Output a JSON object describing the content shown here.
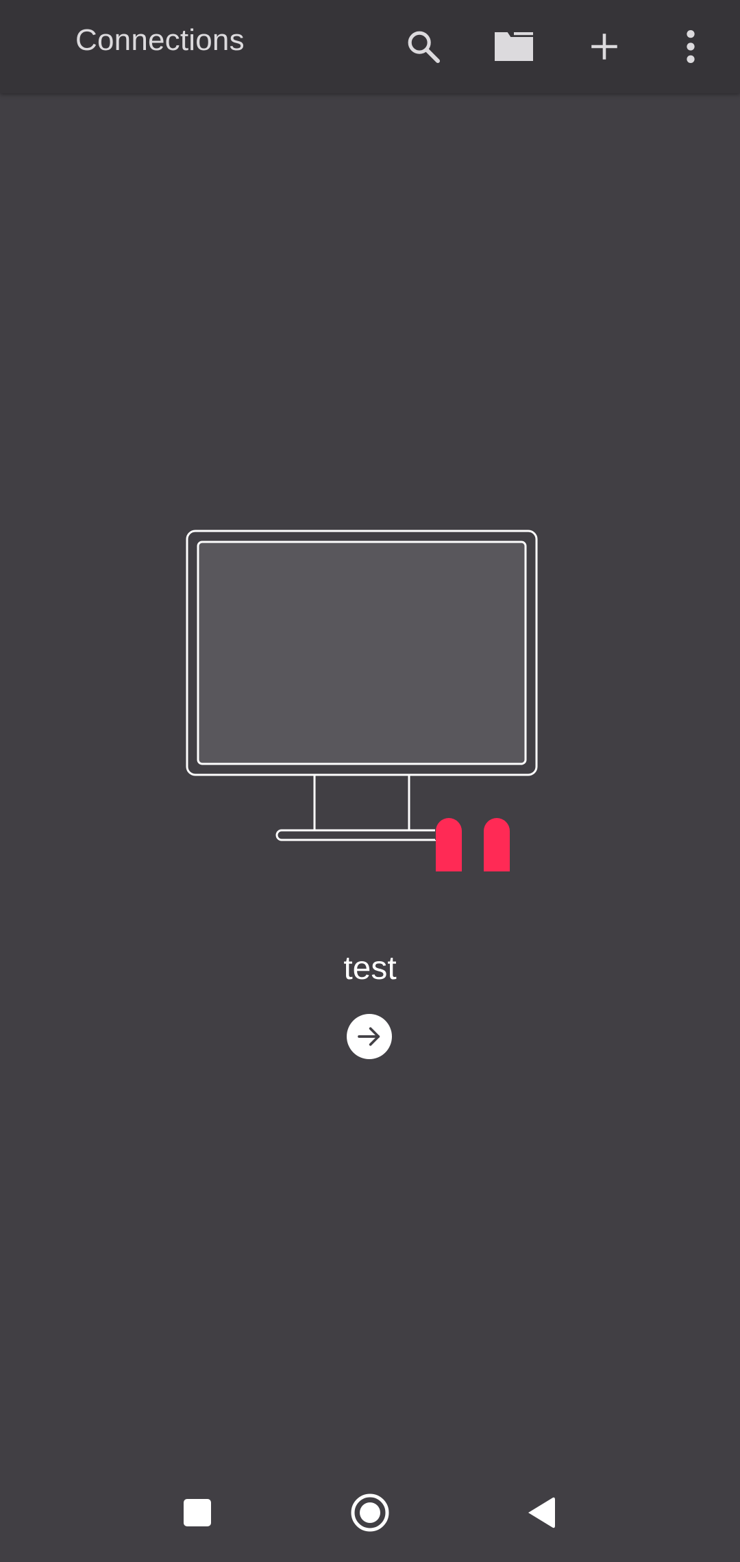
{
  "appbar": {
    "title": "Connections",
    "actions": {
      "search": "search-icon",
      "folder": "folder-icon",
      "add": "plus-icon",
      "more": "more-vert-icon"
    }
  },
  "connection": {
    "name": "test",
    "state_icon": "pause-icon",
    "connect_icon": "arrow-right-icon"
  },
  "colors": {
    "appbar_bg": "#363438",
    "background": "#413f44",
    "screen_fill": "#59575c",
    "pause_accent": "#ff2a55",
    "text": "#ffffff"
  },
  "navbar": {
    "recents": "square-icon",
    "home": "circle-icon",
    "back": "triangle-back-icon"
  }
}
